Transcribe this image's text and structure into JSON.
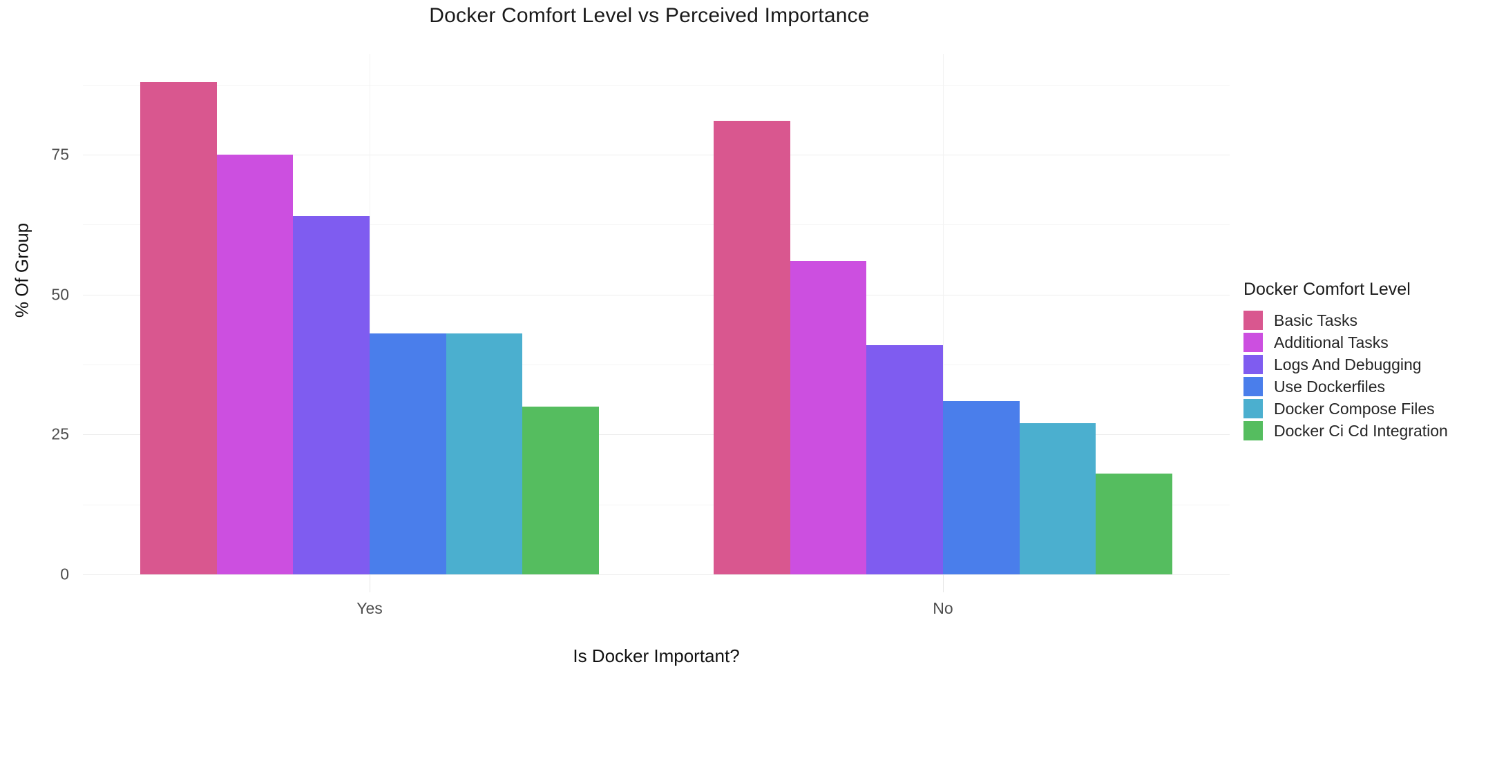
{
  "chart_data": {
    "type": "bar",
    "title": "Docker Comfort Level vs Perceived Importance",
    "xlabel": "Is Docker Important?",
    "ylabel": "% Of Group",
    "categories": [
      "Yes",
      "No"
    ],
    "legend_title": "Docker Comfort Level",
    "legend_position": "right",
    "grid": true,
    "ylim": [
      0,
      93
    ],
    "yticks": [
      0,
      25,
      50,
      75
    ],
    "ytick_labels": [
      "0",
      "25",
      "50",
      "75"
    ],
    "minor_gridlines": [
      12.5,
      37.5,
      62.5,
      87.5
    ],
    "series": [
      {
        "name": "Basic Tasks",
        "color": "#d9578f",
        "values": [
          88,
          81
        ]
      },
      {
        "name": "Additional Tasks",
        "color": "#cc4fe0",
        "values": [
          75,
          56
        ]
      },
      {
        "name": "Logs And Debugging",
        "color": "#7f5cf0",
        "values": [
          64,
          41
        ]
      },
      {
        "name": "Use Dockerfiles",
        "color": "#4a7eeb",
        "values": [
          43,
          31
        ]
      },
      {
        "name": "Docker Compose Files",
        "color": "#4bafcf",
        "values": [
          43,
          27
        ]
      },
      {
        "name": "Docker Ci Cd Integration",
        "color": "#55bd5f",
        "values": [
          30,
          18
        ]
      }
    ]
  }
}
